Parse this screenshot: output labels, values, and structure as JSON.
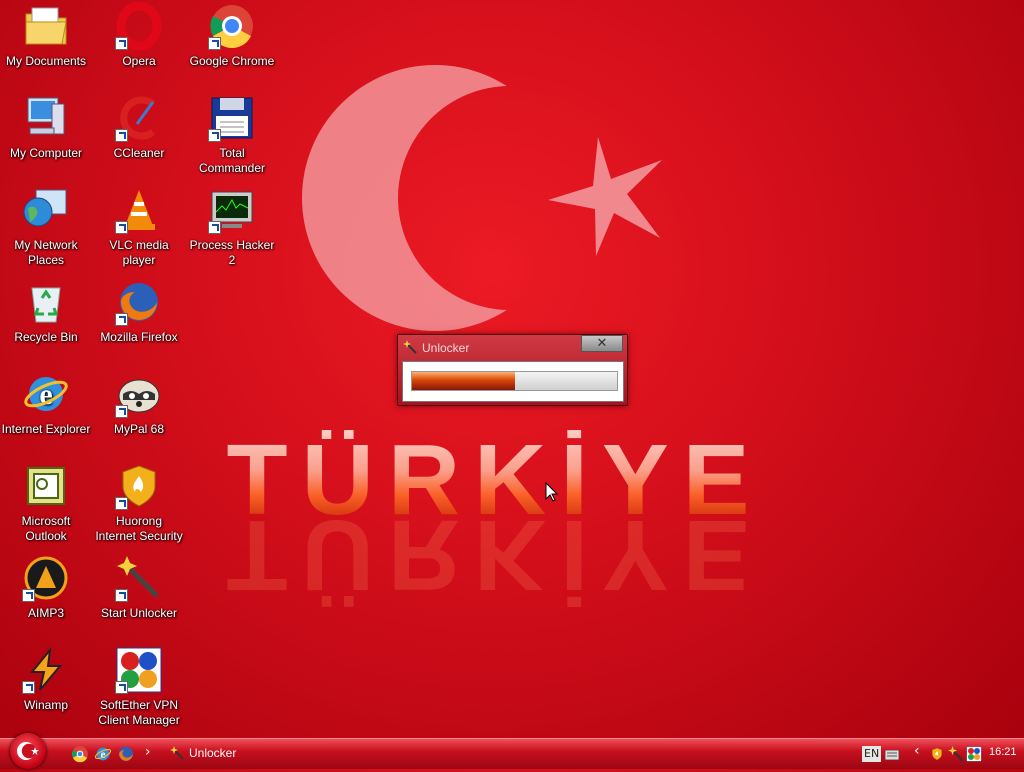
{
  "desktop": {
    "icons": [
      {
        "label": "My Documents",
        "icon": "documents-folder-icon",
        "shortcut": false
      },
      {
        "label": "Opera",
        "icon": "opera-icon",
        "shortcut": true
      },
      {
        "label": "Google Chrome",
        "icon": "chrome-icon",
        "shortcut": true
      },
      {
        "label": "My Computer",
        "icon": "computer-icon",
        "shortcut": false
      },
      {
        "label": "CCleaner",
        "icon": "ccleaner-icon",
        "shortcut": true
      },
      {
        "label": "Total\nCommander",
        "icon": "floppy-disk-icon",
        "shortcut": true
      },
      {
        "label": "My Network\nPlaces",
        "icon": "network-globe-icon",
        "shortcut": false
      },
      {
        "label": "VLC media\nplayer",
        "icon": "vlc-cone-icon",
        "shortcut": true
      },
      {
        "label": "Process Hacker 2",
        "icon": "process-hacker-icon",
        "shortcut": true
      },
      {
        "label": "Recycle Bin",
        "icon": "recycle-bin-icon",
        "shortcut": false
      },
      {
        "label": "Mozilla Firefox",
        "icon": "firefox-icon",
        "shortcut": true
      },
      {
        "label": "Internet Explorer",
        "icon": "internet-explorer-icon",
        "shortcut": false
      },
      {
        "label": "MyPal 68",
        "icon": "raccoon-icon",
        "shortcut": true
      },
      {
        "label": "Microsoft\nOutlook",
        "icon": "outlook-icon",
        "shortcut": false
      },
      {
        "label": "Huorong\nInternet Security",
        "icon": "shield-flame-icon",
        "shortcut": true
      },
      {
        "label": "AIMP3",
        "icon": "aimp-icon",
        "shortcut": true
      },
      {
        "label": "Start Unlocker",
        "icon": "magic-wand-icon",
        "shortcut": true
      },
      {
        "label": "Winamp",
        "icon": "winamp-icon",
        "shortcut": true
      },
      {
        "label": "SoftEther VPN\nClient Manager",
        "icon": "softether-icon",
        "shortcut": true
      }
    ]
  },
  "wallpaper": {
    "text": "TÜRKİYE",
    "colors": {
      "red": "#e30a17",
      "emblem": "#f2a0a4"
    }
  },
  "dialog": {
    "title": "Unlocker",
    "close_label": "✕",
    "progress": 0.5
  },
  "taskbar": {
    "start_icon": "start-orb-icon",
    "quick_launch": [
      "chrome-icon",
      "internet-explorer-icon",
      "firefox-icon"
    ],
    "chevron": "›",
    "task_label": "Unlocker",
    "tray": {
      "language": "EN",
      "chevron": "‹",
      "clock": "16:21"
    }
  }
}
